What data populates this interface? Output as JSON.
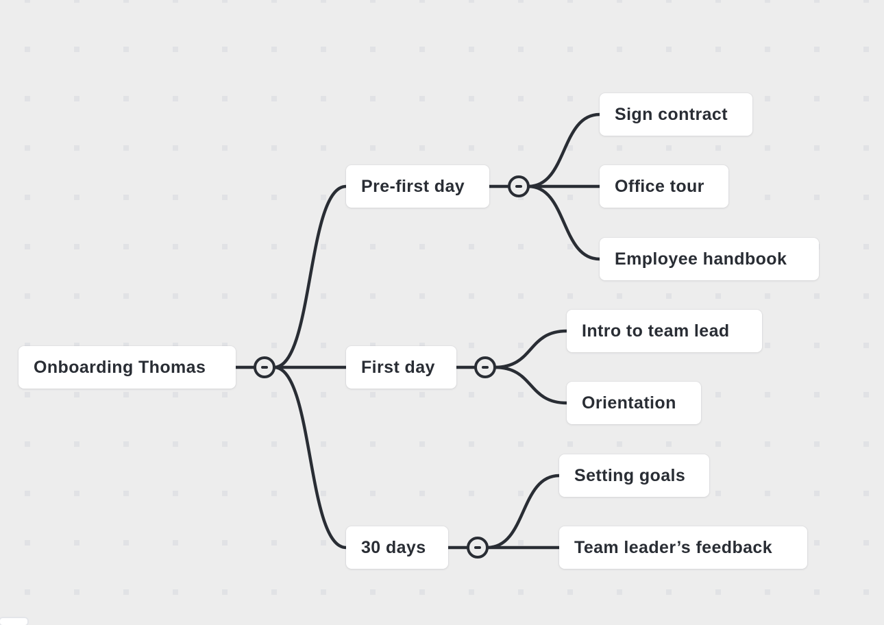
{
  "mindmap": {
    "root": {
      "id": "root",
      "label": "Onboarding Thomas",
      "expanded": true,
      "children": [
        {
          "id": "pre-first-day",
          "label": "Pre-first day",
          "expanded": true,
          "children": [
            {
              "id": "sign-contract",
              "label": "Sign contract"
            },
            {
              "id": "office-tour",
              "label": "Office tour"
            },
            {
              "id": "employee-handbook",
              "label": "Employee handbook"
            }
          ]
        },
        {
          "id": "first-day",
          "label": "First day",
          "expanded": true,
          "children": [
            {
              "id": "intro-to-team-lead",
              "label": "Intro to team lead"
            },
            {
              "id": "orientation",
              "label": "Orientation"
            }
          ]
        },
        {
          "id": "thirty-days",
          "label": "30 days",
          "expanded": true,
          "children": [
            {
              "id": "setting-goals",
              "label": "Setting goals"
            },
            {
              "id": "team-leaders-feedback",
              "label": "Team leader’s feedback"
            }
          ]
        }
      ]
    },
    "toggle_icon": "collapse-minus-icon",
    "colors": {
      "background": "#ededed",
      "grid_dot": "#e1e2e5",
      "node_fill": "#ffffff",
      "text": "#292d34",
      "connector": "#292d34"
    }
  }
}
